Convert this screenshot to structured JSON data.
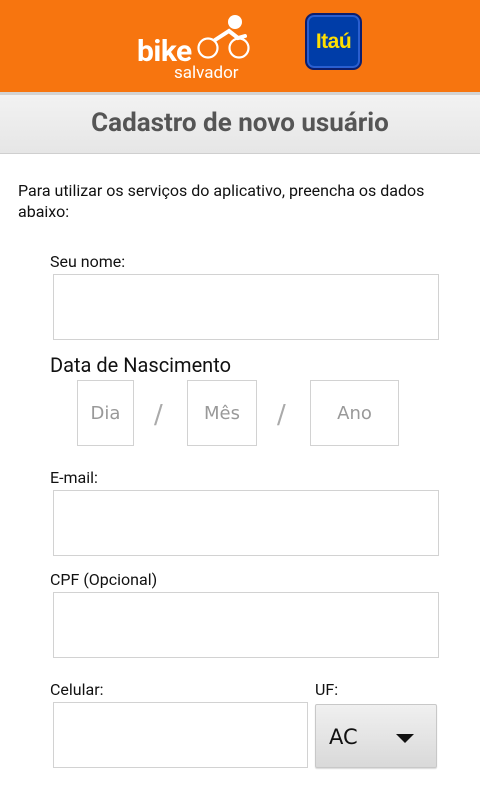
{
  "header": {
    "logo_bike": "bike",
    "logo_city": "salvador",
    "sponsor": "Itaú",
    "brand_color": "#f7750f"
  },
  "title": "Cadastro de novo usuário",
  "intro": "Para utilizar os serviços do aplicativo, preencha os dados abaixo:",
  "form": {
    "name_label": "Seu nome:",
    "name_value": "",
    "birth_label": "Data de Nascimento",
    "day_placeholder": "Dia",
    "month_placeholder": "Mês",
    "year_placeholder": "Ano",
    "separator": "/",
    "email_label": "E-mail:",
    "email_value": "",
    "cpf_label": "CPF (Opcional)",
    "cpf_value": "",
    "phone_label": "Celular:",
    "phone_value": "",
    "uf_label": "UF:",
    "uf_selected": "AC"
  },
  "icons": {
    "cyclist": "cyclist-icon",
    "dropdown": "dropdown-arrow-icon"
  }
}
